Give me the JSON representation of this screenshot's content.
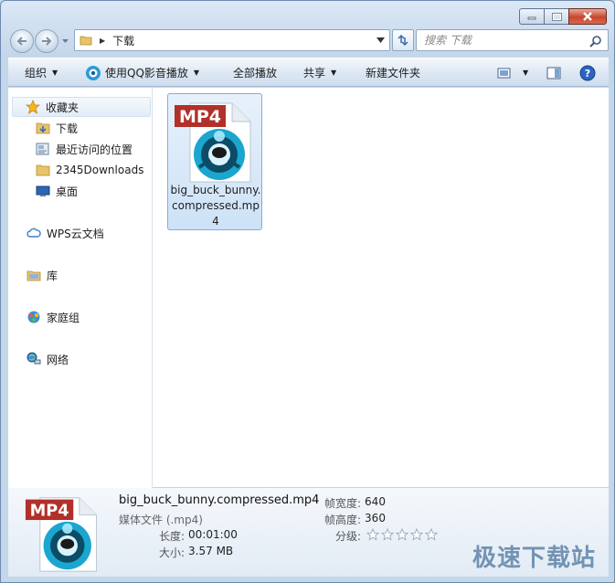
{
  "window": {
    "minimize_icon": "minimize-icon",
    "maximize_icon": "maximize-icon",
    "close_icon": "close-icon"
  },
  "address_bar": {
    "crumb": "下载",
    "refresh_icon": "refresh-icon"
  },
  "search": {
    "placeholder": "搜索 下载",
    "icon": "search-icon"
  },
  "toolbar": {
    "organize": "组织",
    "open_with": "使用QQ影音播放",
    "play_all": "全部播放",
    "share": "共享",
    "new_folder": "新建文件夹"
  },
  "sidebar": {
    "favorites": "收藏夹",
    "fav_items": [
      "下载",
      "最近访问的位置",
      "2345Downloads",
      "桌面"
    ],
    "wps": "WPS云文档",
    "library": "库",
    "homegroup": "家庭组",
    "network": "网络"
  },
  "files": [
    {
      "name": "big_buck_bunny.compressed.mp4",
      "badge": "MP4",
      "icon": "mp4-file-icon"
    }
  ],
  "details": {
    "name": "big_buck_bunny.compressed.mp4",
    "type": "媒体文件 (.mp4)",
    "length_label": "长度:",
    "length": "00:01:00",
    "size_label": "大小:",
    "size": "3.57 MB",
    "width_label": "帧宽度:",
    "width": "640",
    "height_label": "帧高度:",
    "height": "360",
    "rating_label": "分级:",
    "rating": 0,
    "rating_max": 5,
    "badge": "MP4"
  },
  "watermark": "极速下载站",
  "colors": {
    "mp4_badge": "#b2302a",
    "selection": "#cde2f7",
    "accent": "#5f84a8"
  }
}
